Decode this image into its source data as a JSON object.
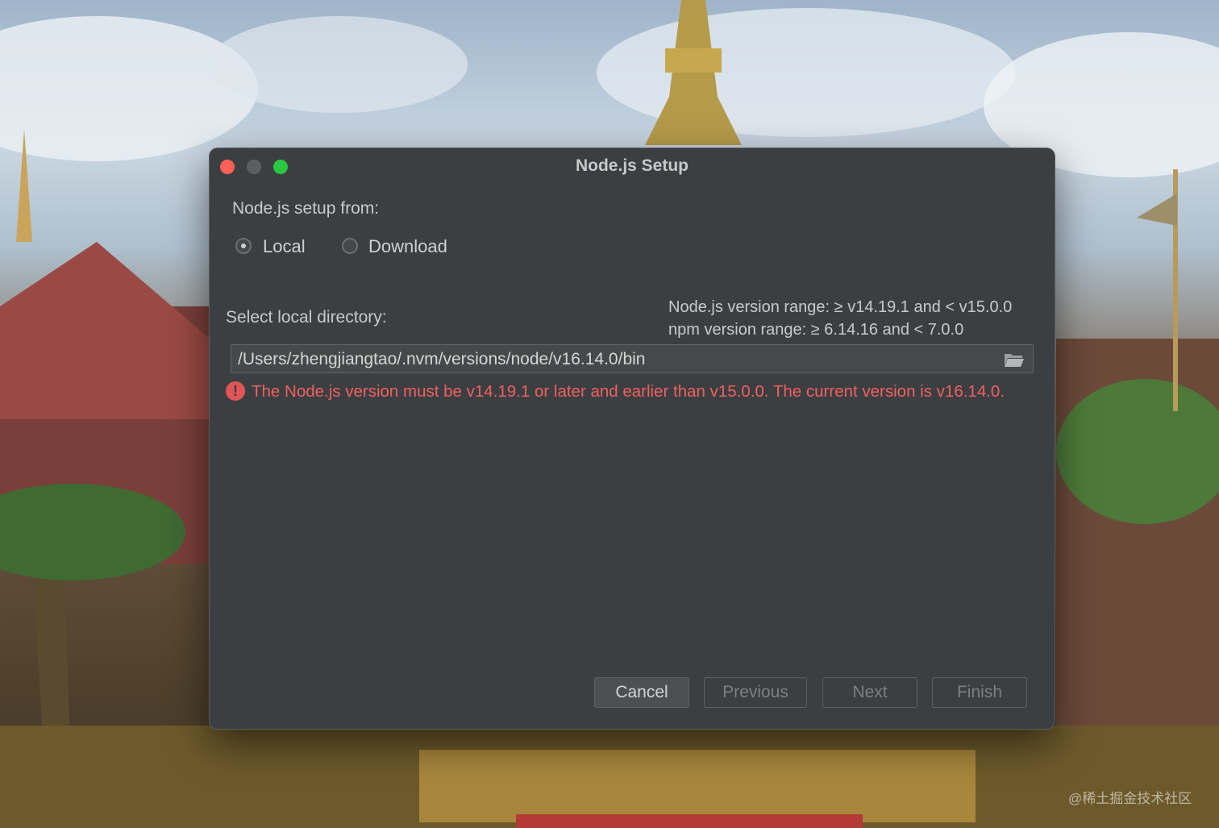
{
  "window": {
    "title": "Node.js Setup"
  },
  "setup_from": {
    "label": "Node.js setup from:",
    "options": [
      {
        "label": "Local",
        "selected": true
      },
      {
        "label": "Download",
        "selected": false
      }
    ]
  },
  "directory": {
    "label": "Select local directory:",
    "value": "/Users/zhengjiangtao/.nvm/versions/node/v16.14.0/bin",
    "browse_icon": "folder-icon"
  },
  "version_info": {
    "node_range": "Node.js version range: ≥ v14.19.1 and < v15.0.0",
    "npm_range": "npm version range: ≥ 6.14.16 and < 7.0.0"
  },
  "error": {
    "icon": "!",
    "message": "The Node.js version must be v14.19.1 or later and earlier than v15.0.0. The current version is v16.14.0."
  },
  "buttons": {
    "cancel": "Cancel",
    "previous": "Previous",
    "next": "Next",
    "finish": "Finish"
  },
  "watermark": "@稀土掘金技术社区",
  "colors": {
    "dialog_bg": "#3c3f41",
    "error": "#f06060",
    "close": "#fe5f57",
    "zoom": "#2ac840"
  }
}
